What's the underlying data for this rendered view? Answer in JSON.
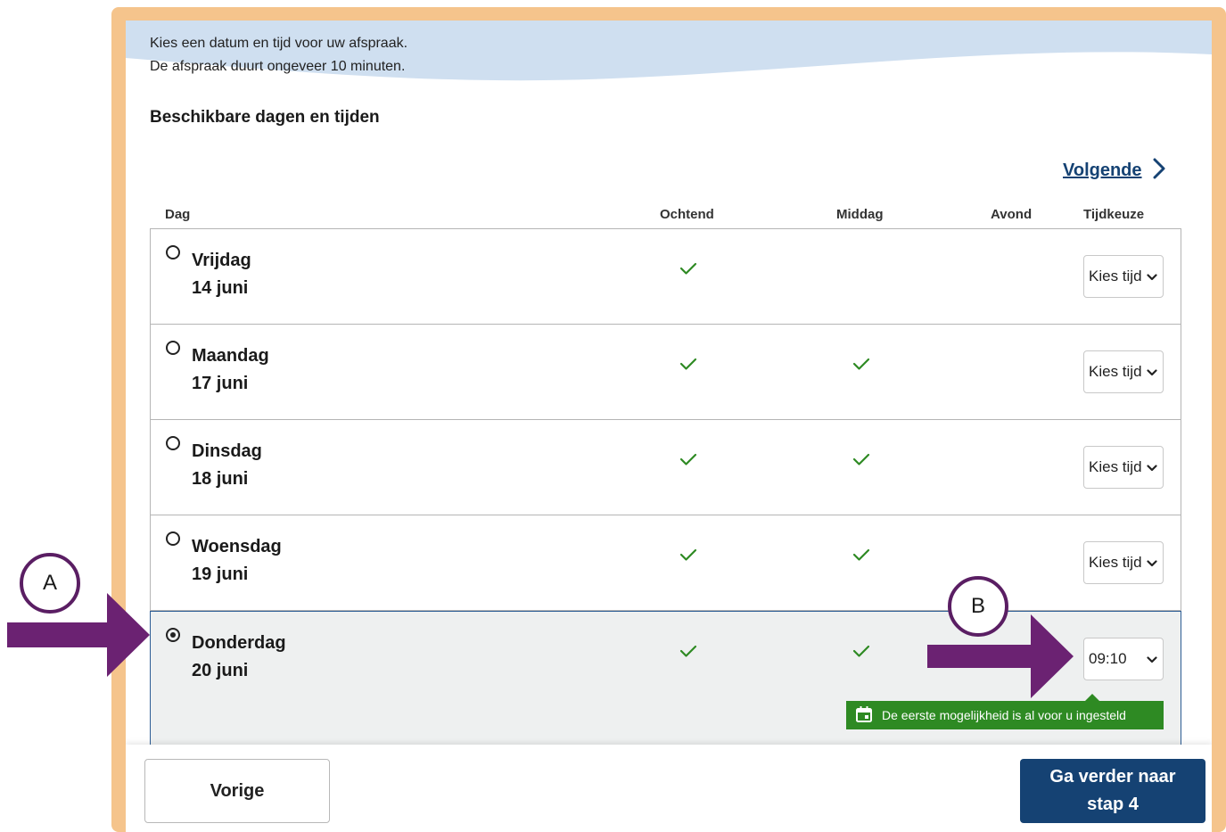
{
  "intro": {
    "line1": "Kies een datum en tijd voor uw afspraak.",
    "line2": "De afspraak duurt ongeveer 10 minuten."
  },
  "heading": "Beschikbare dagen en tijden",
  "next_link": "Volgende",
  "columns": {
    "day": "Dag",
    "morning": "Ochtend",
    "afternoon": "Middag",
    "evening": "Avond",
    "time_choice": "Tijdkeuze"
  },
  "rows": [
    {
      "weekday": "Vrijdag",
      "date": "14 juni",
      "morning": true,
      "afternoon": false,
      "evening": false,
      "time": "Kies tijd",
      "selected": false
    },
    {
      "weekday": "Maandag",
      "date": "17 juni",
      "morning": true,
      "afternoon": true,
      "evening": false,
      "time": "Kies tijd",
      "selected": false
    },
    {
      "weekday": "Dinsdag",
      "date": "18 juni",
      "morning": true,
      "afternoon": true,
      "evening": false,
      "time": "Kies tijd",
      "selected": false
    },
    {
      "weekday": "Woensdag",
      "date": "19 juni",
      "morning": true,
      "afternoon": true,
      "evening": false,
      "time": "Kies tijd",
      "selected": false
    },
    {
      "weekday": "Donderdag",
      "date": "20 juni",
      "morning": true,
      "afternoon": true,
      "evening": false,
      "time": "09:10",
      "selected": true
    }
  ],
  "tooltip": "De eerste mogelijkheid is al voor u ingesteld",
  "footer": {
    "prev": "Vorige",
    "next_line1": "Ga verder naar",
    "next_line2": "stap 4"
  },
  "annotations": {
    "a": "A",
    "b": "B"
  },
  "colors": {
    "frame": "#f5c48c",
    "banner": "#cfdff0",
    "link": "#154273",
    "check": "#2e8a23",
    "selected_row": "#eef0f0",
    "primary_button": "#154273",
    "annotation": "#5a1e63"
  },
  "icons": {
    "next": "chevron-right-icon",
    "available": "checkmark-icon",
    "dropdown": "chevron-down-icon",
    "tooltip": "calendar-icon"
  }
}
